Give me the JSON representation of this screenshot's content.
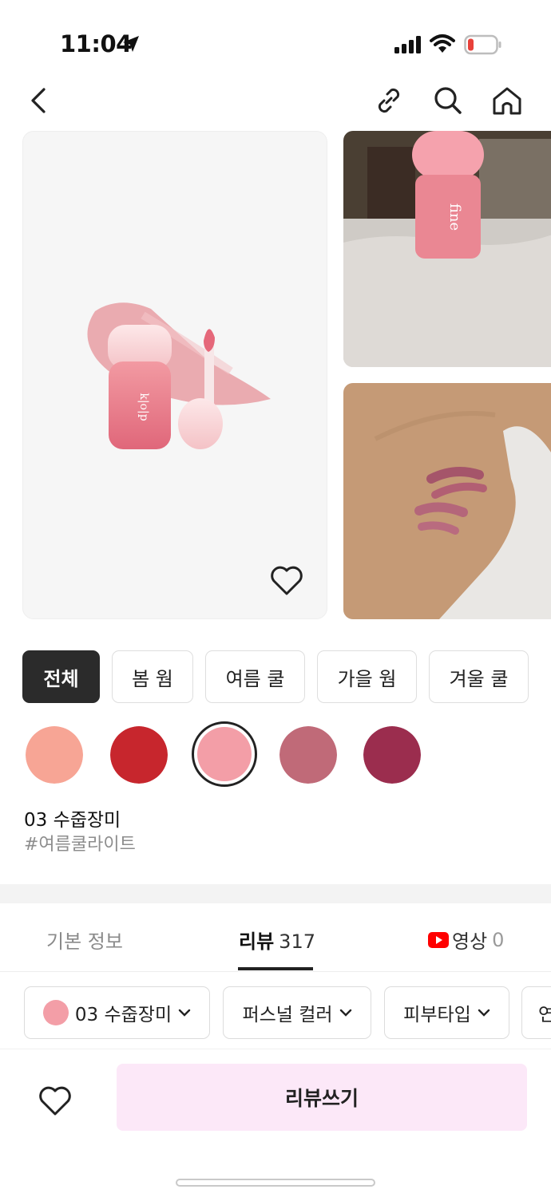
{
  "status": {
    "time": "11:04",
    "battery_color": "#e8413a"
  },
  "nav": {
    "icons": [
      "back-icon",
      "link-icon",
      "search-icon",
      "home-icon"
    ]
  },
  "season_filters": [
    {
      "label": "전체",
      "active": true
    },
    {
      "label": "봄 웜",
      "active": false
    },
    {
      "label": "여름 쿨",
      "active": false
    },
    {
      "label": "가을 웜",
      "active": false
    },
    {
      "label": "겨울 쿨",
      "active": false
    }
  ],
  "swatches": [
    {
      "color": "#f7a595",
      "selected": false
    },
    {
      "color": "#c7262d",
      "selected": false
    },
    {
      "color": "#f39ea7",
      "selected": true
    },
    {
      "color": "#c06a78",
      "selected": false
    },
    {
      "color": "#9b2d4e",
      "selected": false
    }
  ],
  "selected_shade": {
    "name": "03 수줍장미",
    "tag": "#여름쿨라이트"
  },
  "tabs": [
    {
      "label": "기본 정보",
      "count": ""
    },
    {
      "label": "리뷰",
      "count": "317"
    },
    {
      "label": "영상",
      "count": "0"
    }
  ],
  "review_filters": [
    {
      "label": "03 수줍장미",
      "dot_color": "#f39ea7"
    },
    {
      "label": "퍼스널 컬러"
    },
    {
      "label": "피부타입"
    },
    {
      "label": "연"
    }
  ],
  "bottom": {
    "review_button_label": "리뷰쓰기"
  },
  "accent_colors": {
    "youtube_red": "#ff0000",
    "button_pink": "#fce8f8"
  }
}
